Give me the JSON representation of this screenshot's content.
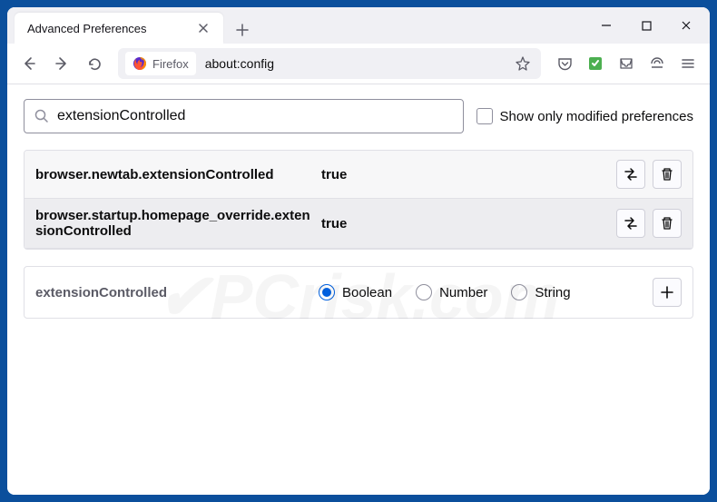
{
  "window": {
    "tab_title": "Advanced Preferences"
  },
  "urlbar": {
    "identity_label": "Firefox",
    "url": "about:config"
  },
  "search": {
    "value": "extensionControlled",
    "checkbox_label": "Show only modified preferences"
  },
  "prefs": [
    {
      "name": "browser.newtab.extensionControlled",
      "value": "true"
    },
    {
      "name": "browser.startup.homepage_override.extensionControlled",
      "value": "true"
    }
  ],
  "add_row": {
    "name": "extensionControlled",
    "types": [
      "Boolean",
      "Number",
      "String"
    ],
    "selected": "Boolean"
  }
}
